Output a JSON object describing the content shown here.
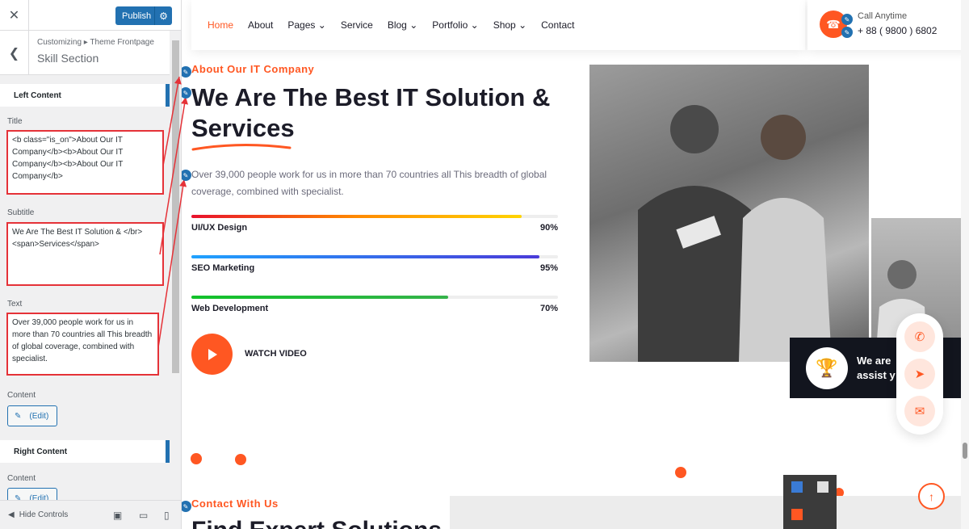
{
  "customizer": {
    "close_icon": "✕",
    "publish_label": "Publish",
    "breadcrumb": "Customizing ▸ Theme Frontpage",
    "section_title": "Skill Section",
    "left_content_label": "Left Content",
    "title_label": "Title",
    "title_value": "<b class=\"is_on\">About Our IT Company</b><b>About Our IT Company</b><b>About Our IT Company</b>",
    "subtitle_label": "Subtitle",
    "subtitle_value": "We Are The Best IT Solution & </br>\n<span>Services</span>",
    "text_label": "Text",
    "text_value": "Over 39,000 people work for us in more than 70 countries all This breadth of global coverage, combined with specialist.",
    "content_label": "Content",
    "edit_label": "(Edit)",
    "right_content_label": "Right Content",
    "content_label_2": "Content",
    "edit_label_2": "(Edit)",
    "hide_controls": "Hide Controls"
  },
  "nav": {
    "items": [
      "Home",
      "About",
      "Pages",
      "Service",
      "Blog",
      "Portfolio",
      "Shop",
      "Contact"
    ],
    "call_title": "Call Anytime",
    "call_number": "+ 88 ( 9800 ) 6802"
  },
  "skill_section": {
    "tagline": "About Our IT Company",
    "headline_1": "We Are The Best IT Solution &",
    "headline_2": "Services",
    "text": "Over 39,000 people work for us in more than 70 countries all This breadth of global coverage, combined with specialist.",
    "skills": [
      {
        "name": "UI/UX Design",
        "percent": "90%",
        "value": 90
      },
      {
        "name": "SEO Marketing",
        "percent": "95%",
        "value": 95
      },
      {
        "name": "Web Development",
        "percent": "70%",
        "value": 70
      }
    ],
    "watch_label": "WATCH VIDEO",
    "award_text_1": "We are",
    "award_text_2": "assist y"
  },
  "contact_section": {
    "tagline": "Contact With Us",
    "headline": "Find Expert Solutions"
  },
  "colors": {
    "accent": "#ff5722",
    "wp_blue": "#2271b1"
  }
}
